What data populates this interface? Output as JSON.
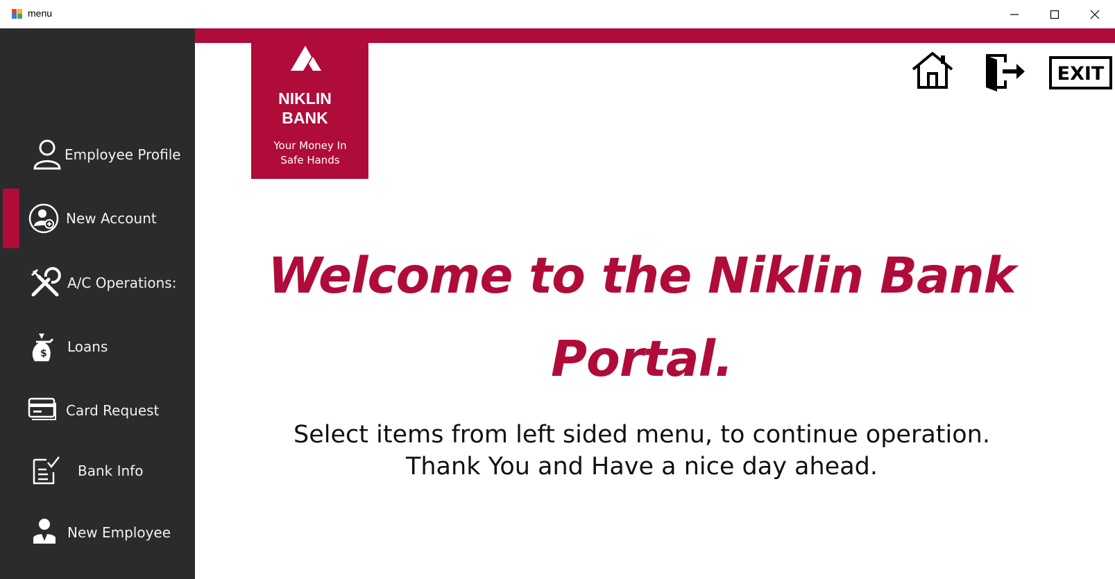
{
  "window": {
    "title": "menu",
    "controls": [
      "minimize",
      "maximize",
      "close"
    ]
  },
  "sidebar": {
    "items": [
      {
        "label": "Employee Profile",
        "icon": "user-icon"
      },
      {
        "label": "New Account",
        "icon": "add-user-circle-icon",
        "selected": true
      },
      {
        "label": "A/C Operations:",
        "icon": "tools-icon"
      },
      {
        "label": "Loans",
        "icon": "money-bag-icon"
      },
      {
        "label": "Card Request",
        "icon": "card-icon"
      },
      {
        "label": "Bank Info",
        "icon": "checklist-icon"
      },
      {
        "label": "New Employee",
        "icon": "employee-icon"
      }
    ]
  },
  "logo": {
    "name_line1": "NIKLIN",
    "name_line2": "BANK",
    "tagline_line1": "Your Money In",
    "tagline_line2": "Safe Hands"
  },
  "actions": {
    "home": "home-icon",
    "logout": "logout-door-icon",
    "exit_label": "EXIT"
  },
  "main": {
    "welcome_line1": "Welcome to the Niklin Bank",
    "welcome_line2": "Portal.",
    "sub_line1": "Select items from left sided menu, to continue operation.",
    "sub_line2": "Thank You and Have a nice day ahead."
  },
  "colors": {
    "brand": "#b00c3a",
    "sidebar_bg": "#2b2a2c",
    "sidebar_text": "#f2f2f2"
  }
}
